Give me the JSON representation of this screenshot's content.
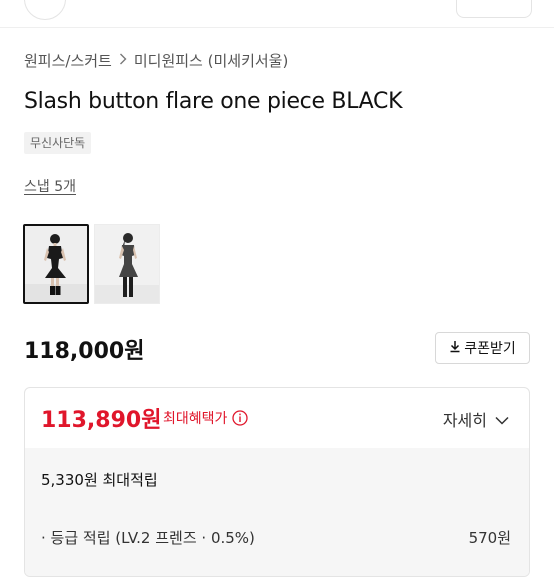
{
  "breadcrumb": {
    "category": "원피스/스커트",
    "subcategory": "미디원피스 (미세키서울)"
  },
  "product": {
    "title": "Slash button flare one piece BLACK",
    "badge": "무신사단독",
    "snap_link": "스냅 5개",
    "thumbnails": [
      {
        "name": "front-view",
        "selected": true
      },
      {
        "name": "full-body-view",
        "selected": false
      }
    ],
    "price": "118,000원"
  },
  "coupon": {
    "label": "쿠폰받기",
    "icon": "download-icon"
  },
  "benefit": {
    "sale_price": "113,890원",
    "sale_label": "최대혜택가",
    "info_icon": "info-icon",
    "detail_label": "자세히",
    "max_points": "5,330원 최대적립",
    "grade_points_label": "· 등급 적립 (LV.2 프렌즈 · 0.5%)",
    "grade_points_value": "570원"
  },
  "colors": {
    "sale_red": "#e0162b",
    "text_dark": "#111111",
    "panel_bg": "#f6f6f6"
  }
}
